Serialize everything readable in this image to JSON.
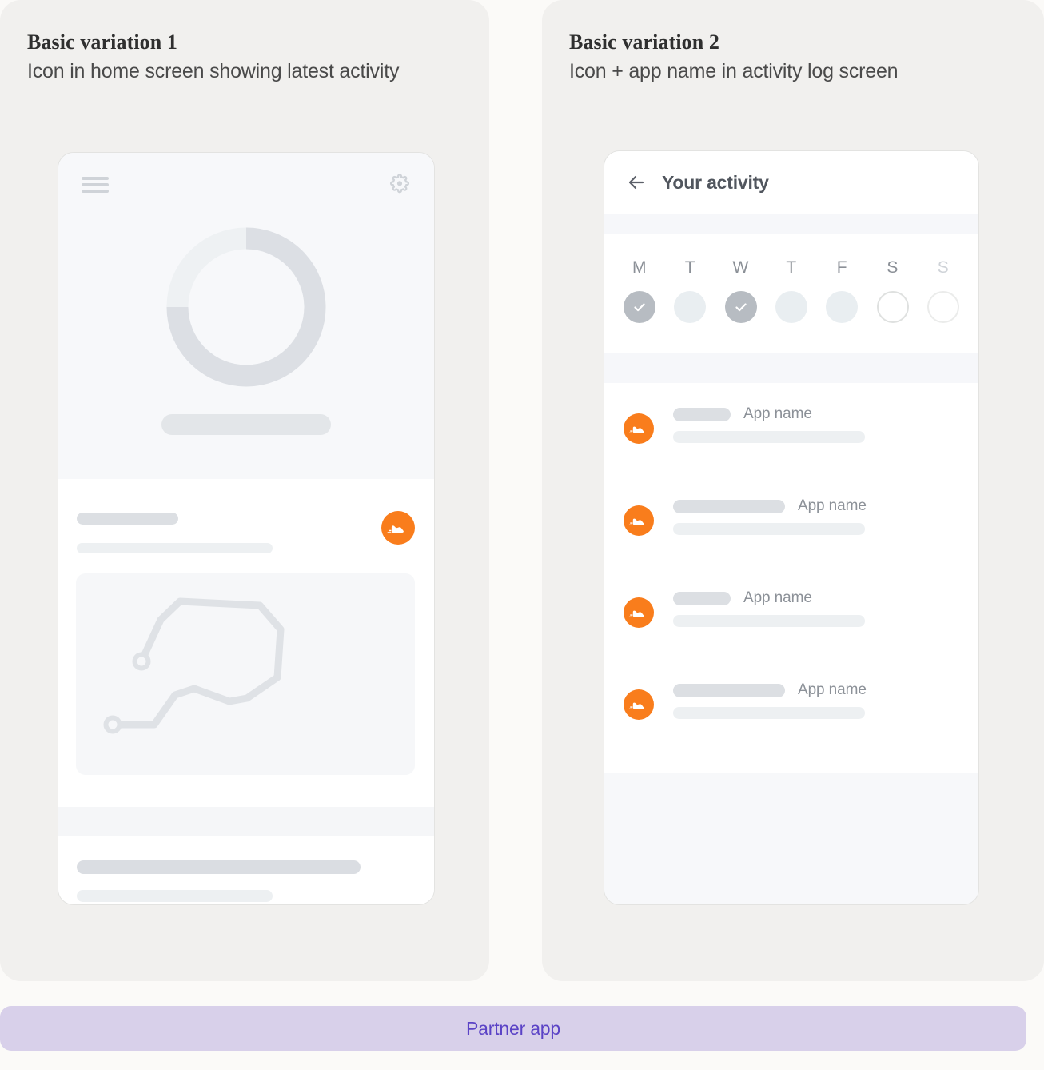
{
  "panels": [
    {
      "id": "basic-variation-1",
      "title": "Basic variation 1",
      "subtitle": "Icon in home screen showing latest activity"
    },
    {
      "id": "basic-variation-2",
      "title": "Basic variation 2",
      "subtitle": "Icon + app name in activity log screen"
    }
  ],
  "phone_home": {
    "menu_icon": "hamburger-menu-icon",
    "settings_icon": "gear-icon",
    "progress_ring": {
      "progress_percent": 75,
      "track_color": "#eef1f3",
      "value_color": "#dcdfe4"
    },
    "activity_badge_icon": "running-shoe-icon",
    "map_route_icon": "route-path-icon"
  },
  "phone_activity_log": {
    "back_icon": "back-arrow-icon",
    "title": "Your activity",
    "week": [
      {
        "label": "M",
        "state": "done",
        "faded": false
      },
      {
        "label": "T",
        "state": "light",
        "faded": false
      },
      {
        "label": "W",
        "state": "done",
        "faded": false
      },
      {
        "label": "T",
        "state": "light",
        "faded": false
      },
      {
        "label": "F",
        "state": "light",
        "faded": false
      },
      {
        "label": "S",
        "state": "empty",
        "faded": false
      },
      {
        "label": "S",
        "state": "empty",
        "faded": true
      }
    ],
    "check_icon": "check-icon",
    "rows": [
      {
        "icon": "running-shoe-icon",
        "pill_width": 72,
        "app_name": "App name"
      },
      {
        "icon": "running-shoe-icon",
        "pill_width": 140,
        "app_name": "App name"
      },
      {
        "icon": "running-shoe-icon",
        "pill_width": 72,
        "app_name": "App name"
      },
      {
        "icon": "running-shoe-icon",
        "pill_width": 140,
        "app_name": "App name"
      }
    ]
  },
  "partner_bar": {
    "label": "Partner app",
    "background_color": "#d8d0ea",
    "text_color": "#5b43c6"
  },
  "colors": {
    "brand_orange": "#f97d1c",
    "panel_bg": "#f1f0ee",
    "page_bg": "#fbfaf8"
  }
}
